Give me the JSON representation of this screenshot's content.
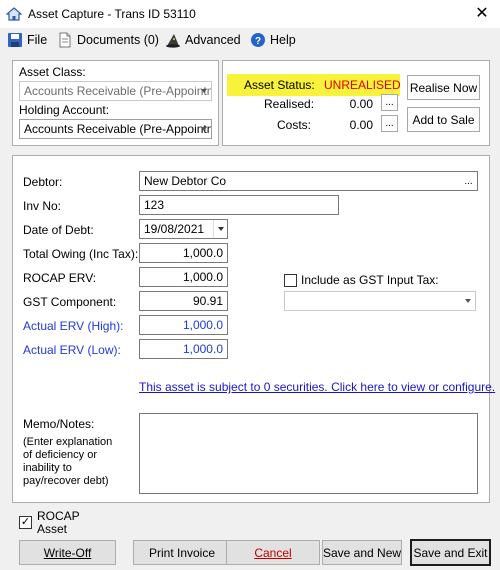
{
  "window": {
    "title": "Asset Capture - Trans ID 53110",
    "close_glyph": "✕"
  },
  "menu": {
    "file": "File",
    "documents": "Documents (0)",
    "advanced": "Advanced",
    "help": "Help"
  },
  "asset": {
    "class_label": "Asset Class:",
    "class_value": "Accounts Receivable (Pre-Appointment)",
    "holding_label": "Holding Account:",
    "holding_value": "Accounts Receivable (Pre-Appointment)"
  },
  "status": {
    "label": "Asset Status:",
    "value": "UNREALISED",
    "realised_label": "Realised:",
    "realised_value": "0.00",
    "costs_label": "Costs:",
    "costs_value": "0.00",
    "ellipsis": "...",
    "realise_now": "Realise Now",
    "add_to_sale": "Add to Sale"
  },
  "form": {
    "debtor_label": "Debtor:",
    "debtor_value": "New Debtor Co",
    "ellipsis": "...",
    "inv_label": "Inv No:",
    "inv_value": "123",
    "date_label": "Date of Debt:",
    "date_value": "19/08/2021",
    "total_label": "Total Owing (Inc Tax):",
    "total_value": "1,000.0",
    "rocap_label": "ROCAP ERV:",
    "rocap_value": "1,000.0",
    "gst_label": "GST Component:",
    "gst_value": "90.91",
    "erv_high_label": "Actual ERV (High):",
    "erv_high_value": "1,000.0",
    "erv_low_label": "Actual ERV (Low):",
    "erv_low_value": "1,000.0",
    "gst_input_label": "Include as GST Input Tax:",
    "gst_input_checked": false,
    "gst_input_select": "",
    "securities_link": "This asset is subject to 0 securities.  Click here to view or configure.",
    "memo_label": "Memo/Notes:",
    "memo_hint": "(Enter explanation of deficiency or inability to pay/recover debt)",
    "memo_value": ""
  },
  "footer": {
    "rocap_asset_label": "ROCAP Asset",
    "rocap_asset_checked": true,
    "check_glyph": "✓",
    "write_off": "Write-Off",
    "print_invoice": "Print Invoice",
    "cancel": "Cancel",
    "save_new": "Save and New",
    "save_exit": "Save and Exit"
  },
  "colors": {
    "status_highlight": "#f8f33a",
    "status_value": "#e00000",
    "erv_label": "#1f3ad9",
    "link": "#1a16c8"
  }
}
